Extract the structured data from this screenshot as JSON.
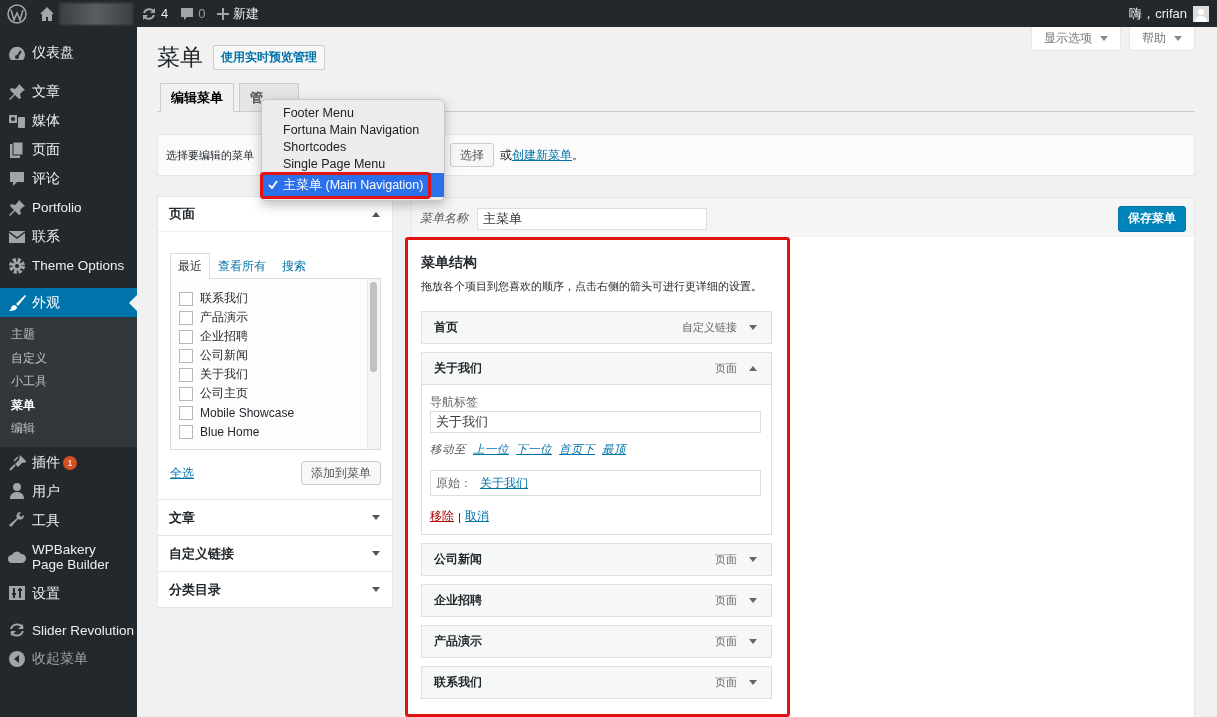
{
  "admin_bar": {
    "updates": "4",
    "comments": "0",
    "new": "新建",
    "greeting": "嗨，crifan"
  },
  "sidebar": {
    "items": [
      {
        "label": "仪表盘",
        "selected": false
      },
      {
        "label": "文章",
        "selected": false
      },
      {
        "label": "媒体",
        "selected": false
      },
      {
        "label": "页面",
        "selected": false
      },
      {
        "label": "评论",
        "selected": false
      },
      {
        "label": "Portfolio",
        "selected": false
      },
      {
        "label": "联系",
        "selected": false
      },
      {
        "label": "Theme Options",
        "selected": false
      },
      {
        "label": "外观",
        "selected": true,
        "children": [
          {
            "label": "主题",
            "selected": false
          },
          {
            "label": "自定义",
            "selected": false
          },
          {
            "label": "小工具",
            "selected": false
          },
          {
            "label": "菜单",
            "selected": true
          },
          {
            "label": "编辑",
            "selected": false
          }
        ]
      },
      {
        "label": "插件",
        "selected": false,
        "badge": "1"
      },
      {
        "label": "用户",
        "selected": false
      },
      {
        "label": "工具",
        "selected": false
      },
      {
        "label": "WPBakery Page Builder",
        "selected": false
      },
      {
        "label": "设置",
        "selected": false
      },
      {
        "label": "Slider Revolution",
        "selected": false
      }
    ],
    "collapse": "收起菜单"
  },
  "top_buttons": [
    {
      "label": "显示选项"
    },
    {
      "label": "帮助"
    }
  ],
  "page": {
    "title": "菜单",
    "action": "使用实时预览管理"
  },
  "tabs": [
    {
      "label": "编辑菜单",
      "selected": true
    },
    {
      "label": "管",
      "selected": false
    }
  ],
  "menu_select": {
    "label": "选择要编辑的菜单",
    "options": [
      {
        "label": "Footer Menu",
        "selected": false
      },
      {
        "label": "Fortuna Main Navigation",
        "selected": false
      },
      {
        "label": "Shortcodes",
        "selected": false
      },
      {
        "label": "Single Page Menu",
        "selected": false
      },
      {
        "label": "主菜单 (Main Navigation)",
        "selected": true,
        "annotated": true
      }
    ],
    "button": "选择",
    "prompt_prefix": "或",
    "create_link": "创建新菜单",
    "prompt_suffix": "。"
  },
  "add_panel": {
    "sections": [
      {
        "title": "页面",
        "expanded": true
      },
      {
        "title": "文章",
        "expanded": false
      },
      {
        "title": "自定义链接",
        "expanded": false
      },
      {
        "title": "分类目录",
        "expanded": false
      }
    ],
    "tabs": [
      {
        "label": "最近",
        "selected": true
      },
      {
        "label": "查看所有",
        "selected": false
      },
      {
        "label": "搜索",
        "selected": false
      }
    ],
    "pages": [
      {
        "label": "联系我们",
        "checked": false
      },
      {
        "label": "产品演示",
        "checked": false
      },
      {
        "label": "企业招聘",
        "checked": false
      },
      {
        "label": "公司新闻",
        "checked": false
      },
      {
        "label": "关于我们",
        "checked": false
      },
      {
        "label": "公司主页",
        "checked": false
      },
      {
        "label": "Mobile Showcase",
        "checked": false
      },
      {
        "label": "Blue Home",
        "checked": false
      }
    ],
    "select_all": "全选",
    "add_button": "添加到菜单"
  },
  "menu_editor": {
    "name_label": "菜单名称",
    "name_value": "主菜单",
    "save_button": "保存菜单",
    "structure": {
      "title": "菜单结构",
      "description": "拖放各个项目到您喜欢的顺序，点击右侧的箭头可进行更详细的设置。",
      "annotated": true,
      "items": [
        {
          "title": "首页",
          "type": "自定义链接",
          "expanded": false
        },
        {
          "title": "关于我们",
          "type": "页面",
          "expanded": true,
          "settings": {
            "nav_label": "导航标签",
            "nav_value": "关于我们",
            "move_label": "移动至",
            "move_links": [
              "上一位",
              "下一位",
              "首页下",
              "最顶"
            ],
            "original_label": "原始：",
            "original_link": "关于我们",
            "remove": "移除",
            "separator": "|",
            "cancel": "取消"
          }
        },
        {
          "title": "公司新闻",
          "type": "页面",
          "expanded": false
        },
        {
          "title": "企业招聘",
          "type": "页面",
          "expanded": false
        },
        {
          "title": "产品演示",
          "type": "页面",
          "expanded": false
        },
        {
          "title": "联系我们",
          "type": "页面",
          "expanded": false
        }
      ]
    }
  }
}
